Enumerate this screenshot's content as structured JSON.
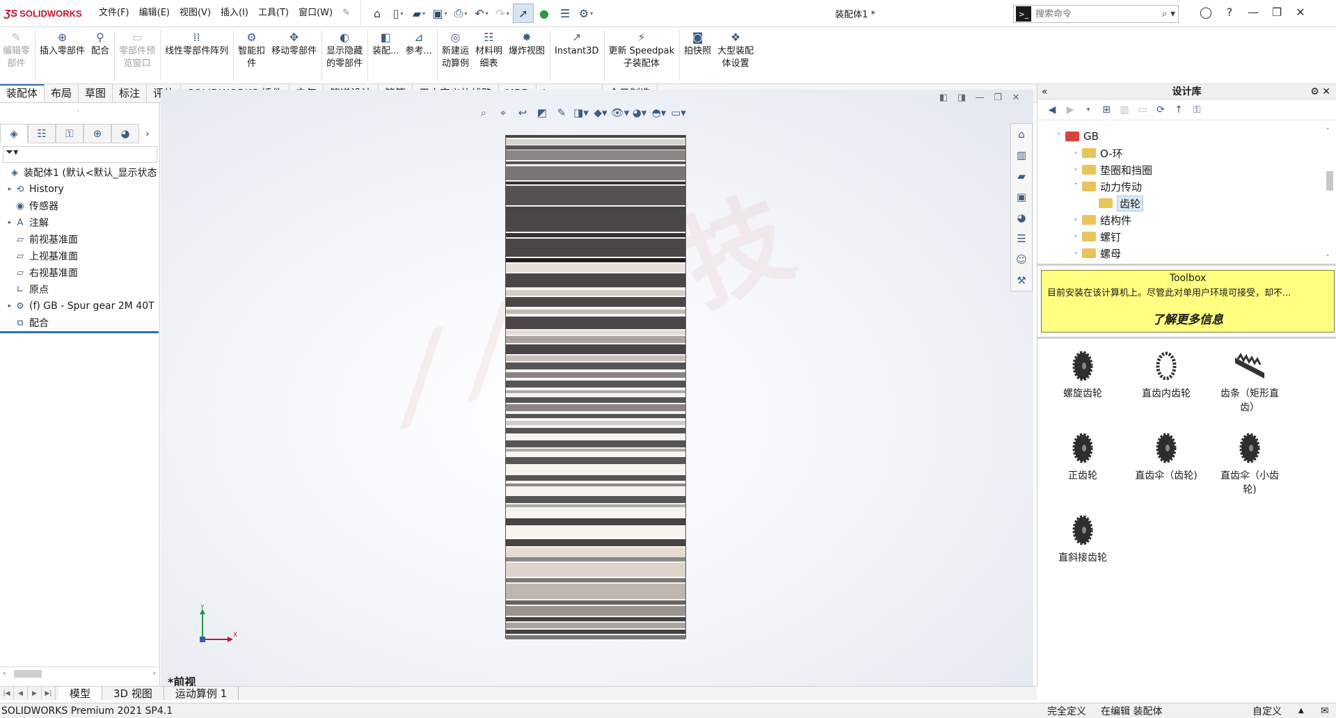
{
  "app": {
    "logo": "SOLIDWORKS",
    "document_title": "装配体1 *",
    "search_placeholder": "搜索命令"
  },
  "menu": [
    "文件(F)",
    "编辑(E)",
    "视图(V)",
    "插入(I)",
    "工具(T)",
    "窗口(W)"
  ],
  "command_manager": [
    {
      "label": "编辑零\n部件",
      "icon": "edit-component-icon",
      "disabled": true
    },
    {
      "label": "插入零部件",
      "icon": "insert-component-icon",
      "disabled": false
    },
    {
      "label": "配合",
      "icon": "mate-icon",
      "disabled": false
    },
    {
      "label": "零部件预\n览窗口",
      "icon": "preview-window-icon",
      "disabled": true
    },
    {
      "label": "线性零部件阵列",
      "icon": "linear-pattern-icon",
      "disabled": false
    },
    {
      "label": "智能扣\n件",
      "icon": "smart-fastener-icon",
      "disabled": false
    },
    {
      "label": "移动零部件",
      "icon": "move-component-icon",
      "disabled": false
    },
    {
      "label": "显示隐藏\n的零部件",
      "icon": "show-hidden-icon",
      "disabled": false
    },
    {
      "label": "装配...",
      "icon": "assembly-feature-icon",
      "disabled": false
    },
    {
      "label": "参考...",
      "icon": "reference-geometry-icon",
      "disabled": false
    },
    {
      "label": "新建运\n动算例",
      "icon": "new-motion-study-icon",
      "disabled": false
    },
    {
      "label": "材料明\n细表",
      "icon": "bom-icon",
      "disabled": false
    },
    {
      "label": "爆炸视图",
      "icon": "exploded-view-icon",
      "disabled": false
    },
    {
      "label": "Instant3D",
      "icon": "instant3d-icon",
      "disabled": false
    },
    {
      "label": "更新 Speedpak\n子装配体",
      "icon": "speedpak-icon",
      "disabled": false
    },
    {
      "label": "拍快照",
      "icon": "snapshot-icon",
      "disabled": false
    },
    {
      "label": "大型装配\n体设置",
      "icon": "large-assembly-icon",
      "disabled": false
    }
  ],
  "tabs": [
    "装配体",
    "布局",
    "草图",
    "标注",
    "评估",
    "SOLIDWORKS 插件",
    "电气",
    "管道设计",
    "管筒",
    "用户定义的线路",
    "MBD",
    "Logopress",
    "今日制造"
  ],
  "active_tab": 0,
  "feature_tree": [
    {
      "label": "装配体1 (默认<默认_显示状态",
      "icon": "assembly-icon",
      "expandable": false,
      "indent": 0
    },
    {
      "label": "History",
      "icon": "history-icon",
      "expandable": true,
      "indent": 1
    },
    {
      "label": "传感器",
      "icon": "sensor-icon",
      "expandable": false,
      "indent": 1
    },
    {
      "label": "注解",
      "icon": "annotation-icon",
      "expandable": true,
      "indent": 1
    },
    {
      "label": "前视基准面",
      "icon": "plane-icon",
      "expandable": false,
      "indent": 1
    },
    {
      "label": "上视基准面",
      "icon": "plane-icon",
      "expandable": false,
      "indent": 1
    },
    {
      "label": "右视基准面",
      "icon": "plane-icon",
      "expandable": false,
      "indent": 1
    },
    {
      "label": "原点",
      "icon": "origin-icon",
      "expandable": false,
      "indent": 1
    },
    {
      "label": "(f) GB - Spur gear 2M 40T",
      "icon": "part-icon",
      "expandable": true,
      "indent": 1
    },
    {
      "label": "配合",
      "icon": "mates-folder-icon",
      "expandable": false,
      "indent": 1
    }
  ],
  "view_label": "*前视",
  "triad": {
    "x": "X",
    "y": "Y"
  },
  "design_library": {
    "title": "设计库",
    "tree": [
      {
        "label": "GB",
        "indent": 0,
        "expanded": true,
        "color": "#d9443a"
      },
      {
        "label": "O-环",
        "indent": 1,
        "expanded": false,
        "color": "#e8c45a"
      },
      {
        "label": "垫圈和挡圈",
        "indent": 1,
        "expanded": false,
        "color": "#e8c45a"
      },
      {
        "label": "动力传动",
        "indent": 1,
        "expanded": true,
        "color": "#e8c45a"
      },
      {
        "label": "齿轮",
        "indent": 2,
        "expanded": null,
        "color": "#e8c45a",
        "selected": true
      },
      {
        "label": "结构件",
        "indent": 1,
        "expanded": false,
        "color": "#e8c45a"
      },
      {
        "label": "螺钉",
        "indent": 1,
        "expanded": false,
        "color": "#e8c45a"
      },
      {
        "label": "螺母",
        "indent": 1,
        "expanded": false,
        "color": "#e8c45a"
      }
    ],
    "toolbox": {
      "title": "Toolbox",
      "text": "目前安装在该计算机上。尽管此对单用户环境可接受，却不...",
      "link": "了解更多信息"
    },
    "gears": [
      {
        "label": "螺旋齿轮",
        "icon": "helical-gear-icon"
      },
      {
        "label": "直齿内齿轮",
        "icon": "internal-gear-icon"
      },
      {
        "label": "齿条（矩形直\n齿）",
        "icon": "rack-icon"
      },
      {
        "label": "正齿轮",
        "icon": "spur-gear-icon"
      },
      {
        "label": "直齿伞（齿轮)",
        "icon": "bevel-gear-icon"
      },
      {
        "label": "直齿伞（小齿\n轮)",
        "icon": "bevel-pinion-icon"
      },
      {
        "label": "直斜接齿轮",
        "icon": "miter-gear-icon"
      }
    ]
  },
  "bottom_tabs": [
    "模型",
    "3D 视图",
    "运动算例 1"
  ],
  "status": {
    "app": "SOLIDWORKS Premium 2021 SP4.1",
    "definition": "完全定义",
    "editing": "在编辑 装配体",
    "custom": "自定义"
  }
}
